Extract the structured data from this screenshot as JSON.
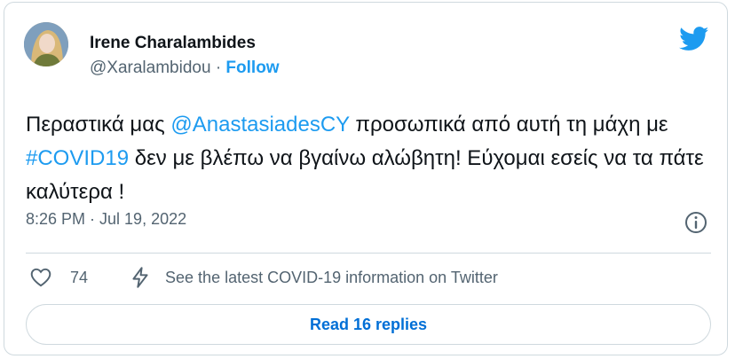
{
  "author": {
    "name": "Irene Charalambides",
    "handle": "@Xaralambidou",
    "separator": "·",
    "follow_label": "Follow"
  },
  "tweet": {
    "segments": [
      {
        "text": "Περαστικά μας ",
        "type": "text"
      },
      {
        "text": "@AnastasiadesCY",
        "type": "mention"
      },
      {
        "text": " προσωπικά από αυτή τη μάχη με ",
        "type": "text"
      },
      {
        "text": "#COVID19",
        "type": "hashtag"
      },
      {
        "text": " δεν με βλέπω να βγαίνω αλώβητη! Εύχομαι εσείς να τα πάτε καλύτερα !",
        "type": "text"
      }
    ],
    "timestamp": "8:26 PM · Jul 19, 2022"
  },
  "actions": {
    "like_count": "74",
    "covid_info": "See the latest COVID-19 information on Twitter"
  },
  "read_replies_label": "Read 16 replies",
  "icons": {
    "brand": "twitter-bird-icon",
    "info": "info-icon",
    "like": "heart-icon",
    "covid": "lightning-bolt-icon"
  },
  "colors": {
    "accent": "#1d9bf0",
    "text": "#0f1419",
    "secondary": "#536471",
    "border": "#cfd9de"
  }
}
